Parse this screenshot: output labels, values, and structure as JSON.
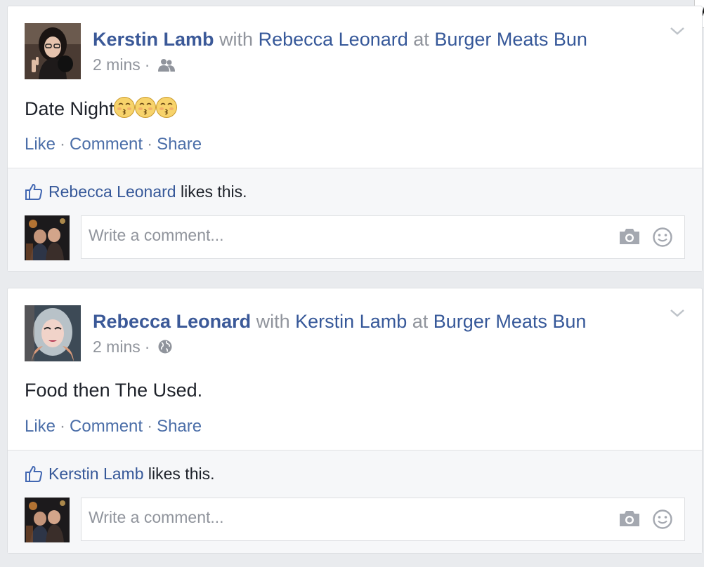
{
  "corner_tab": {
    "text": "V"
  },
  "posts": [
    {
      "author": "Kerstin Lamb",
      "with_word": "with",
      "tagged": "Rebecca Leonard",
      "at_word": "at",
      "place": "Burger Meats Bun",
      "time": "2 mins",
      "audience_icon": "friends-icon",
      "text": "Date Night",
      "emoji": [
        "kissing-face-emoji",
        "kissing-face-emoji",
        "kissing-face-emoji"
      ],
      "actions": {
        "like": "Like",
        "comment": "Comment",
        "share": "Share"
      },
      "liker": "Rebecca Leonard",
      "likes_suffix": "likes this.",
      "comment_placeholder": "Write a comment..."
    },
    {
      "author": "Rebecca Leonard",
      "with_word": "with",
      "tagged": "Kerstin Lamb",
      "at_word": "at",
      "place": "Burger Meats Bun",
      "time": "2 mins",
      "audience_icon": "globe-icon",
      "text": "Food then The Used.",
      "actions": {
        "like": "Like",
        "comment": "Comment",
        "share": "Share"
      },
      "liker": "Kerstin Lamb",
      "likes_suffix": "likes this.",
      "comment_placeholder": "Write a comment..."
    }
  ],
  "colors": {
    "link": "#365899",
    "author": "#3b5998",
    "muted": "#90949c",
    "background": "#e9ebee"
  }
}
